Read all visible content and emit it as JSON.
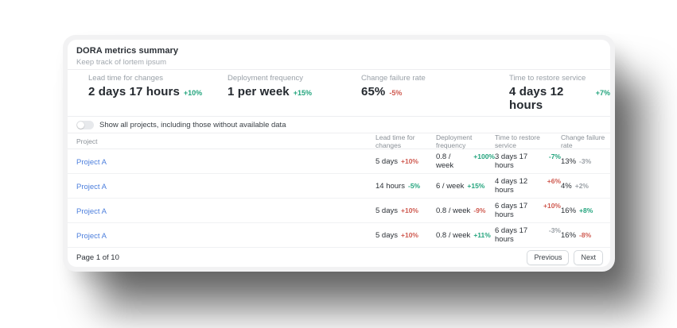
{
  "card": {
    "title": "DORA metrics summary",
    "subtitle": "Keep track of lortem ipsum"
  },
  "metrics": [
    {
      "label": "Lead time for changes",
      "value": "2 days 17 hours",
      "delta": "+10%",
      "color": "green"
    },
    {
      "label": "Deployment frequency",
      "value": "1 per week",
      "delta": "+15%",
      "color": "green"
    },
    {
      "label": "Change failure rate",
      "value": "65%",
      "delta": "-5%",
      "color": "red"
    },
    {
      "label": "Time to restore service",
      "value": "4 days 12 hours",
      "delta": "+7%",
      "color": "green"
    }
  ],
  "toggle": {
    "label": "Show all projects, including those without available data",
    "state": "off"
  },
  "table": {
    "columns": [
      "Project",
      "Lead time for changes",
      "Deployment frequency",
      "Time to restore service",
      "Change failure rate"
    ],
    "rows": [
      {
        "project": "Project A",
        "lead": {
          "value": "5 days",
          "delta": "+10%",
          "color": "red"
        },
        "deploy": {
          "value": "0.8 / week",
          "delta": "+100%",
          "color": "green"
        },
        "restore": {
          "value": "3 days 17 hours",
          "delta": "-7%",
          "color": "green"
        },
        "failure": {
          "value": "13%",
          "delta": "-3%",
          "color": "gray"
        }
      },
      {
        "project": "Project A",
        "lead": {
          "value": "14 hours",
          "delta": "-5%",
          "color": "green"
        },
        "deploy": {
          "value": "6 / week",
          "delta": "+15%",
          "color": "green"
        },
        "restore": {
          "value": "4 days 12 hours",
          "delta": "+6%",
          "color": "red"
        },
        "failure": {
          "value": "4%",
          "delta": "+2%",
          "color": "gray"
        }
      },
      {
        "project": "Project A",
        "lead": {
          "value": "5 days",
          "delta": "+10%",
          "color": "red"
        },
        "deploy": {
          "value": "0.8 / week",
          "delta": "-9%",
          "color": "red"
        },
        "restore": {
          "value": "6 days 17 hours",
          "delta": "+10%",
          "color": "red"
        },
        "failure": {
          "value": "16%",
          "delta": "+8%",
          "color": "green"
        }
      },
      {
        "project": "Project A",
        "lead": {
          "value": "5 days",
          "delta": "+10%",
          "color": "red"
        },
        "deploy": {
          "value": "0.8 / week",
          "delta": "+11%",
          "color": "green"
        },
        "restore": {
          "value": "6 days 17 hours",
          "delta": "-3%",
          "color": "gray"
        },
        "failure": {
          "value": "16%",
          "delta": "-8%",
          "color": "red"
        }
      }
    ]
  },
  "pagination": {
    "status": "Page 1 of 10",
    "previous_label": "Previous",
    "next_label": "Next"
  },
  "colors": {
    "green": "#23a47d",
    "red": "#cf5a50",
    "gray": "#9aa0a6",
    "link": "#4d7fdd"
  }
}
